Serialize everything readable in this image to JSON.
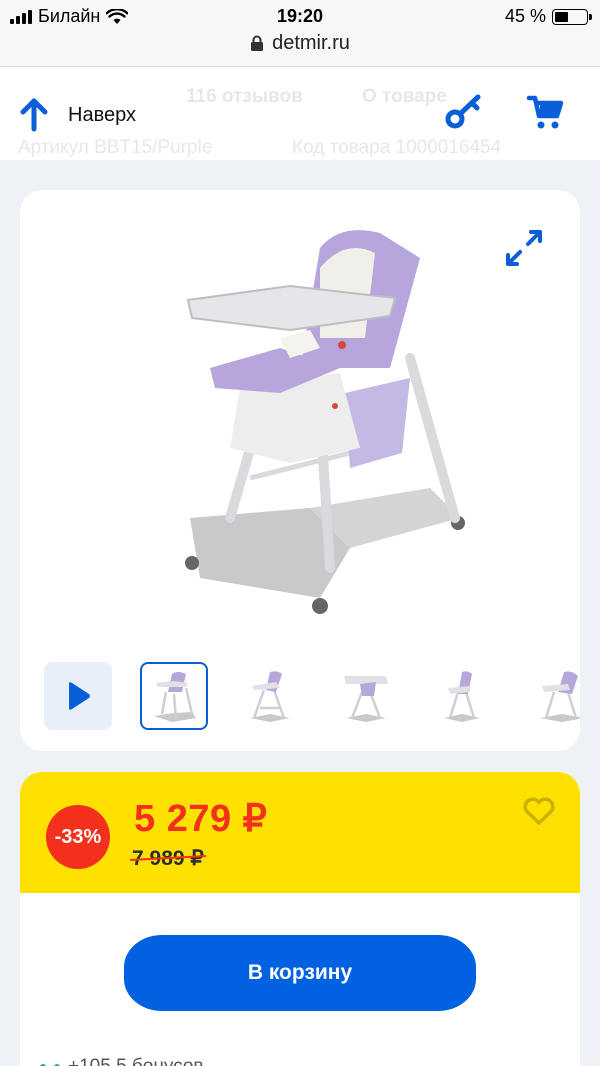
{
  "status_bar": {
    "carrier": "Билайн",
    "time": "19:20",
    "battery_percent": "45 %",
    "battery_level": 0.45,
    "url": "detmir.ru"
  },
  "header": {
    "back_label": "Наверх",
    "ghost_reviews": "116 отзывов",
    "ghost_about": "О товаре",
    "ghost_article": "Артикул BBT15/Purple",
    "ghost_code": "Код товара 1000016454"
  },
  "gallery": {
    "thumb_count": 6,
    "active_thumb_index": 1
  },
  "price": {
    "discount": "-33%",
    "current": "5 279 ₽",
    "old": "7 989 ₽"
  },
  "actions": {
    "add_to_cart": "В корзину",
    "bonus": "+105,5 бонусов"
  },
  "colors": {
    "accent": "#0062e0",
    "price_red": "#f2301c",
    "band_yellow": "#ffe100",
    "chair_purple": "#b7a6dc"
  }
}
